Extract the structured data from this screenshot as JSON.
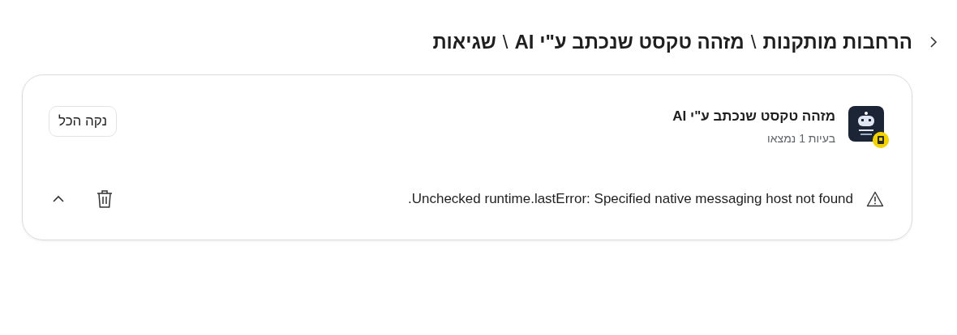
{
  "breadcrumb": [
    {
      "text": "הרחבות מותקנות"
    },
    {
      "text": "\\",
      "kind": "separator"
    },
    {
      "text": "מזהה טקסט שנכתב ע\"י AI"
    },
    {
      "text": "\\",
      "kind": "separator"
    },
    {
      "text": "שגיאות"
    }
  ],
  "extension": {
    "name": "מזהה טקסט שנכתב ע\"י AI",
    "issues": "בעיות 1 נמצאו"
  },
  "clear_button": "נקה הכל",
  "errors": [
    {
      "message": "Unchecked runtime.lastError: Specified native messaging host not found.",
      "expanded": true
    }
  ]
}
